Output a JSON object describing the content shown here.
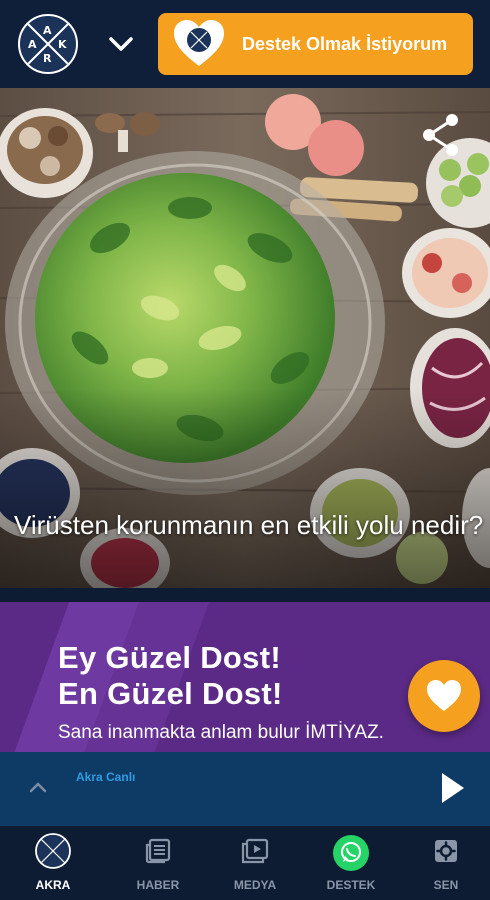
{
  "header": {
    "logo_letters": [
      "A",
      "K",
      "R",
      "A"
    ],
    "support_button_label": "Destek Olmak İstiyorum"
  },
  "hero": {
    "headline": "Virüsten korunmanın en etkili yolu nedir?"
  },
  "banner": {
    "line1": "Ey Güzel Dost!",
    "line2": "En Güzel Dost!",
    "line3": "Sana inanmakta anlam bulur İMTİYAZ."
  },
  "player": {
    "station_name": "Akra Canlı"
  },
  "bottom_nav": {
    "items": [
      {
        "label": "AKRA",
        "icon": "akra-logo-icon",
        "active": true
      },
      {
        "label": "HABER",
        "icon": "news-icon",
        "active": false
      },
      {
        "label": "MEDYA",
        "icon": "media-play-icon",
        "active": false
      },
      {
        "label": "DESTEK",
        "icon": "whatsapp-icon",
        "active": false
      },
      {
        "label": "SEN",
        "icon": "settings-icon",
        "active": false
      }
    ]
  },
  "colors": {
    "header_bg": "#0f1f3a",
    "accent_orange": "#f5a01e",
    "banner_purple": "#5b2a86",
    "player_blue": "#0e3a66",
    "station_blue": "#2f9be0",
    "whatsapp_green": "#25d366"
  }
}
